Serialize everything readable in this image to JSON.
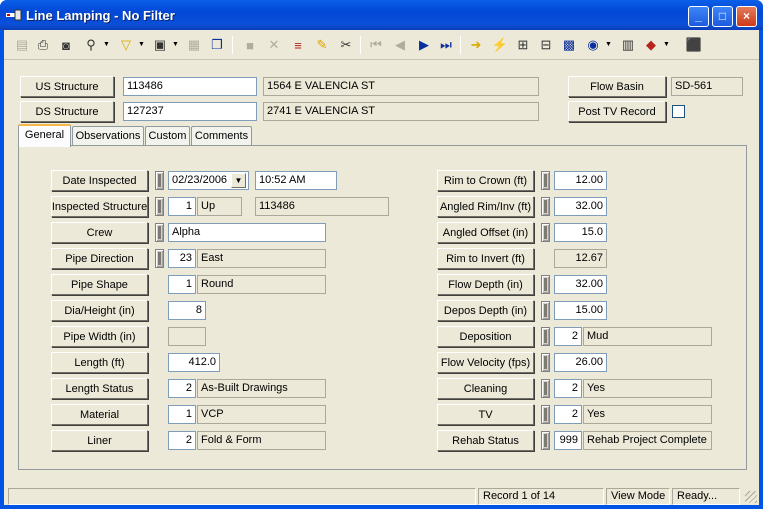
{
  "window": {
    "title": "Line Lamping - No Filter",
    "controls": {
      "minimize": "_",
      "maximize": "□",
      "close": "×"
    }
  },
  "toolbar": {
    "icons": [
      "sort-icon",
      "print-icon",
      "preview-icon",
      "find-icon",
      "filter-icon",
      "form-icon",
      "copy-form-icon",
      "copy-icon",
      "save-icon",
      "delete-icon",
      "stack-icon",
      "pencil-icon",
      "scissors-icon",
      "first-record-icon",
      "prev-record-icon",
      "next-record-icon",
      "last-record-icon",
      "arrow-right-icon",
      "lightning-icon",
      "tree-icon",
      "network-icon",
      "screen-icon",
      "globe-icon",
      "calculator-icon",
      "book-icon",
      "exit-icon"
    ]
  },
  "header": {
    "us_structure_label": "US Structure",
    "us_structure_id": "113486",
    "us_structure_address": "1564  E  VALENCIA ST",
    "ds_structure_label": "DS Structure",
    "ds_structure_id": "127237",
    "ds_structure_address": "2741  E  VALENCIA ST",
    "flow_basin_label": "Flow Basin",
    "flow_basin_value": "SD-561",
    "post_tv_label": "Post TV Record"
  },
  "tabs": [
    {
      "label": "General",
      "active": true
    },
    {
      "label": "Observations",
      "active": false
    },
    {
      "label": "Custom",
      "active": false
    },
    {
      "label": "Comments",
      "active": false
    }
  ],
  "left": {
    "date_inspected": {
      "label": "Date Inspected",
      "date": "02/23/2006",
      "time": "10:52 AM"
    },
    "inspected_structure": {
      "label": "Inspected Structure",
      "code": "1",
      "desc": "Up",
      "value": "113486"
    },
    "crew": {
      "label": "Crew",
      "value": "Alpha"
    },
    "pipe_direction": {
      "label": "Pipe Direction",
      "code": "23",
      "desc": "East"
    },
    "pipe_shape": {
      "label": "Pipe Shape",
      "code": "1",
      "desc": "Round"
    },
    "dia_height": {
      "label": "Dia/Height (in)",
      "value": "8"
    },
    "pipe_width": {
      "label": "Pipe Width (in)",
      "value": ""
    },
    "length": {
      "label": "Length (ft)",
      "value": "412.0"
    },
    "length_status": {
      "label": "Length Status",
      "code": "2",
      "desc": "As-Built Drawings"
    },
    "material": {
      "label": "Material",
      "code": "1",
      "desc": "VCP"
    },
    "liner": {
      "label": "Liner",
      "code": "2",
      "desc": "Fold & Form"
    }
  },
  "right": {
    "rim_to_crown": {
      "label": "Rim to Crown (ft)",
      "value": "12.00"
    },
    "angled_rim_inv": {
      "label": "Angled Rim/Inv (ft)",
      "value": "32.00"
    },
    "angled_offset": {
      "label": "Angled Offset (in)",
      "value": "15.0"
    },
    "rim_to_invert": {
      "label": "Rim to Invert (ft)",
      "value": "12.67"
    },
    "flow_depth": {
      "label": "Flow Depth (in)",
      "value": "32.00"
    },
    "depos_depth": {
      "label": "Depos Depth (in)",
      "value": "15.00"
    },
    "deposition": {
      "label": "Deposition",
      "code": "2",
      "desc": "Mud"
    },
    "flow_velocity": {
      "label": "Flow Velocity (fps)",
      "value": "26.00"
    },
    "cleaning": {
      "label": "Cleaning",
      "code": "2",
      "desc": "Yes"
    },
    "tv": {
      "label": "TV",
      "code": "2",
      "desc": "Yes"
    },
    "rehab_status": {
      "label": "Rehab Status",
      "code": "999",
      "desc": "Rehab Project Complete"
    }
  },
  "status": {
    "record": "Record 1 of 14",
    "mode": "View Mode",
    "state": "Ready..."
  }
}
